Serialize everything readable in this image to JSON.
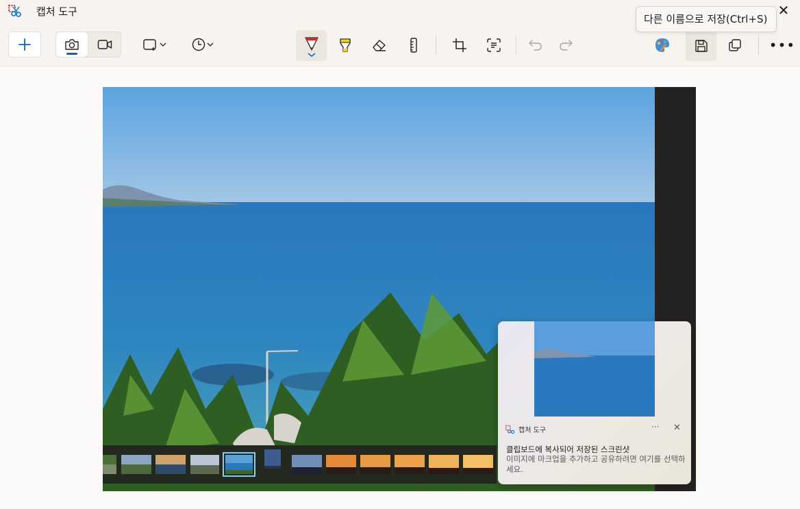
{
  "window": {
    "title": "캡처 도구",
    "close_glyph": "✕"
  },
  "toolbar": {
    "new_label": "+",
    "tooltip": "다른 이름으로 저장(Ctrl+S)",
    "more_label": "•••",
    "icons": [
      "plus-icon",
      "camera-icon",
      "video-icon",
      "rectangle-snip-icon",
      "clock-icon",
      "pen-icon",
      "highlighter-icon",
      "eraser-icon",
      "ruler-icon",
      "crop-icon",
      "text-actions-icon",
      "undo-icon",
      "redo-icon",
      "paint-icon",
      "save-icon",
      "copy-icon",
      "more-icon"
    ],
    "accent_color": "#0a62c9",
    "pen_color": "#e8202a",
    "highlighter_color": "#f2d21b"
  },
  "filmstrip": {
    "thumb_count": 12,
    "selected_index": 4
  },
  "toast": {
    "app_name": "캡처 도구",
    "more_label": "···",
    "close_label": "✕",
    "title": "클립보드에 복사되어 저장된 스크린샷",
    "body": "이미지에 마크업을 추가하고 공유하려면 여기를 선택하세요."
  }
}
